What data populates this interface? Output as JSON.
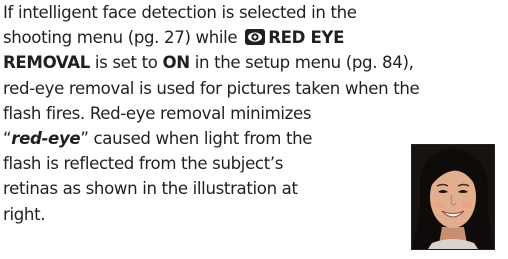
{
  "paragraph": {
    "line1": "If intelligent face detection is selected in the",
    "line2_before": "shooting menu (pg. 27) while ",
    "line2_setting": "RED EYE",
    "line3_setting": "REMOVAL",
    "line3_mid": " is set to ",
    "line3_value": "ON",
    "line3_after": " in the setup menu (pg. 84),",
    "line4": "red-eye removal is used for pictures taken when the",
    "line5": "flash fires.  Red-eye removal minimizes",
    "line6_quote_open": "“",
    "line6_term": "red-eye",
    "line6_after": "” caused when light from the",
    "line7": "flash is reflected from the subject’s",
    "line8": "retinas as shown in the illustration at",
    "line9": "right."
  },
  "icons": {
    "setting_icon": "red-eye-removal-icon"
  },
  "illustration": {
    "subject": "smiling-woman-portrait"
  }
}
